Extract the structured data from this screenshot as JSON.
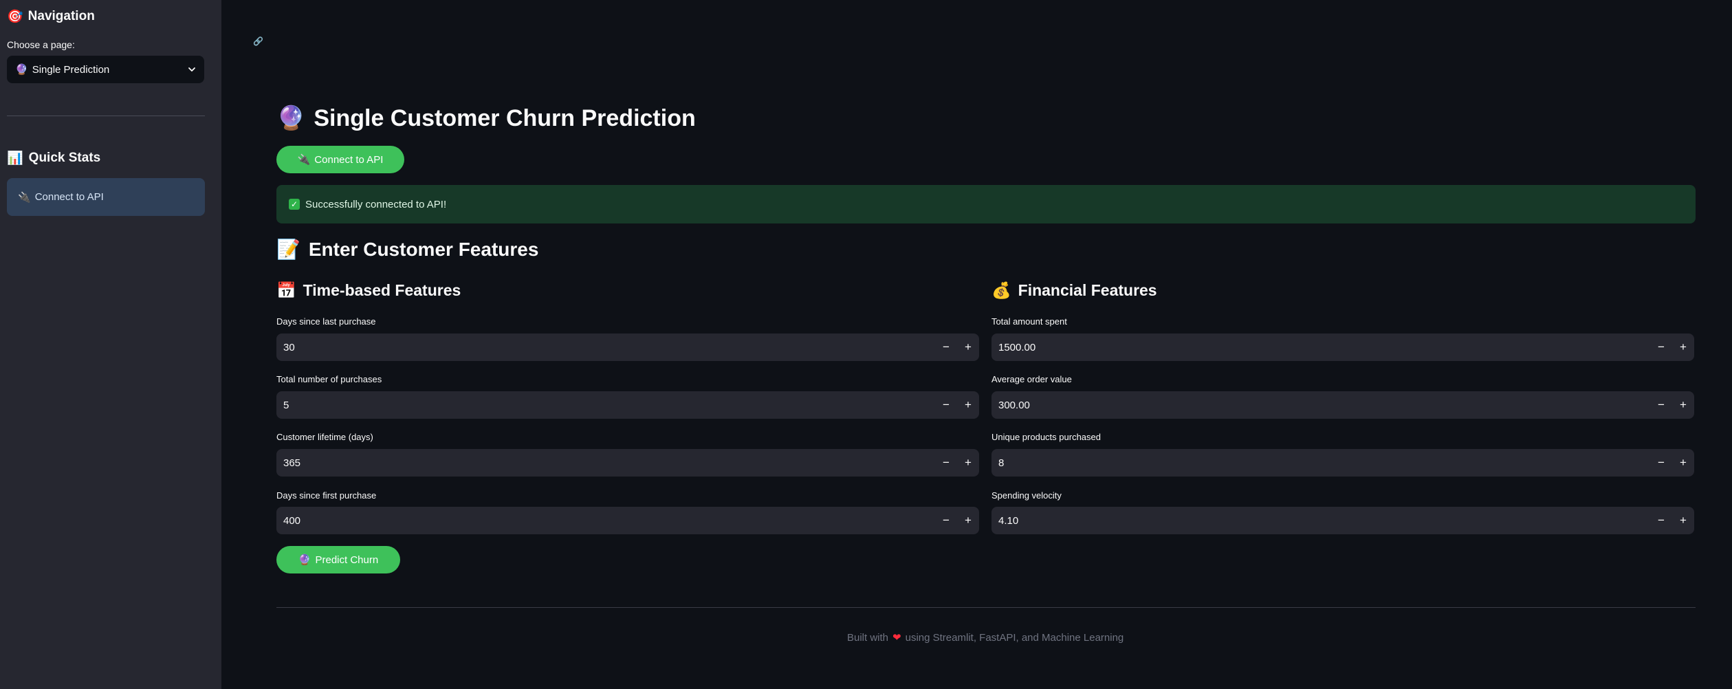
{
  "sidebar": {
    "nav_icon": "🎯",
    "nav_title": "Navigation",
    "choose_label": "Choose a page:",
    "select_icon": "🔮",
    "select_value": "Single Prediction",
    "quick_stats_icon": "📊",
    "quick_stats_title": "Quick Stats",
    "quick_stats_icon2": "🔌",
    "quick_stats_text": "Connect to API"
  },
  "main": {
    "link_icon": "🔗",
    "title_icon": "🔮",
    "title": "Single Customer Churn Prediction",
    "connect_icon": "🔌",
    "connect_label": "Connect to API",
    "success_text": "Successfully connected to API!",
    "section_icon": "📝",
    "section_title": "Enter Customer Features",
    "time_col": {
      "icon": "📅",
      "title": "Time-based Features",
      "fields": [
        {
          "label": "Days since last purchase",
          "value": "30"
        },
        {
          "label": "Total number of purchases",
          "value": "5"
        },
        {
          "label": "Customer lifetime (days)",
          "value": "365"
        },
        {
          "label": "Days since first purchase",
          "value": "400"
        }
      ]
    },
    "fin_col": {
      "icon": "💰",
      "title": "Financial Features",
      "fields": [
        {
          "label": "Total amount spent",
          "value": "1500.00"
        },
        {
          "label": "Average order value",
          "value": "300.00"
        },
        {
          "label": "Unique products purchased",
          "value": "8"
        },
        {
          "label": "Spending velocity",
          "value": "4.10"
        }
      ]
    },
    "minus": "−",
    "plus": "+",
    "predict_icon": "🔮",
    "predict_label": "Predict Churn"
  },
  "footer": {
    "prefix": "Built with",
    "heart": "❤",
    "suffix": "using Streamlit, FastAPI, and Machine Learning"
  },
  "colors": {
    "background": "#0e1117",
    "sidebar": "#262730",
    "accent_green": "#3ec15a",
    "success_bg": "#173928",
    "info_bg": "#2f4058"
  }
}
